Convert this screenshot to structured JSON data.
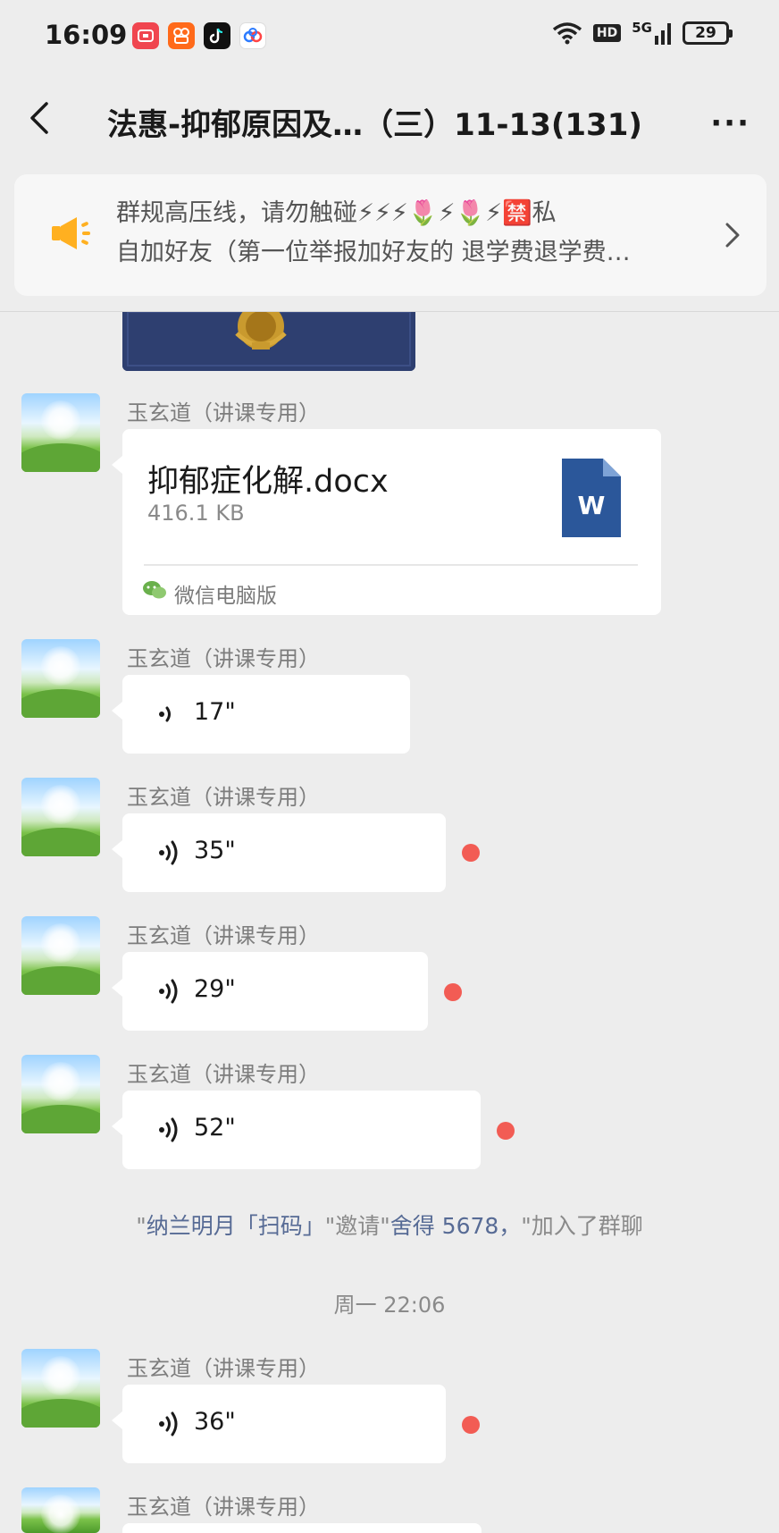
{
  "status_bar": {
    "time": "16:09",
    "hd_label": "HD",
    "network_label": "5G",
    "battery": "29",
    "app_icons": [
      "video-app-icon",
      "kuaishou-icon",
      "tiktok-icon",
      "baidu-netdisk-icon"
    ]
  },
  "header": {
    "title": "法惠-抑郁原因及…（三）11-13(131)",
    "more_label": "···"
  },
  "notice": {
    "line1": "群规高压线，请勿触碰⚡⚡⚡🌷⚡🌷⚡🈲私",
    "line2": "自加好友（第一位举报加好友的 退学费退学费…"
  },
  "messages": {
    "file_msg": {
      "sender": "玉玄道（讲课专用）",
      "file_name": "抑郁症化解.docx",
      "file_size": "416.1 KB",
      "file_type_letter": "W",
      "source": "微信电脑版"
    },
    "voice_1": {
      "sender": "玉玄道（讲课专用）",
      "duration": "17\"",
      "unread": false
    },
    "voice_2": {
      "sender": "玉玄道（讲课专用）",
      "duration": "35\"",
      "unread": true
    },
    "voice_3": {
      "sender": "玉玄道（讲课专用）",
      "duration": "29\"",
      "unread": true
    },
    "voice_4": {
      "sender": "玉玄道（讲课专用）",
      "duration": "52\"",
      "unread": true
    },
    "voice_5": {
      "sender": "玉玄道（讲课专用）",
      "duration": "36\"",
      "unread": true
    },
    "partial_sender": "玉玄道（讲课专用）"
  },
  "system": {
    "invite": {
      "q1": "\"",
      "inviter": "纳兰明月「扫码」",
      "mid": "\"邀请\"",
      "invitee": "舍得 5678，",
      "end": "\"加入了群聊"
    },
    "timestamp": "周一 22:06"
  },
  "colors": {
    "background": "#ededed",
    "bubble": "#ffffff",
    "unread_dot": "#f25c54",
    "link_name": "#576b95",
    "word_icon": "#2b579a"
  }
}
